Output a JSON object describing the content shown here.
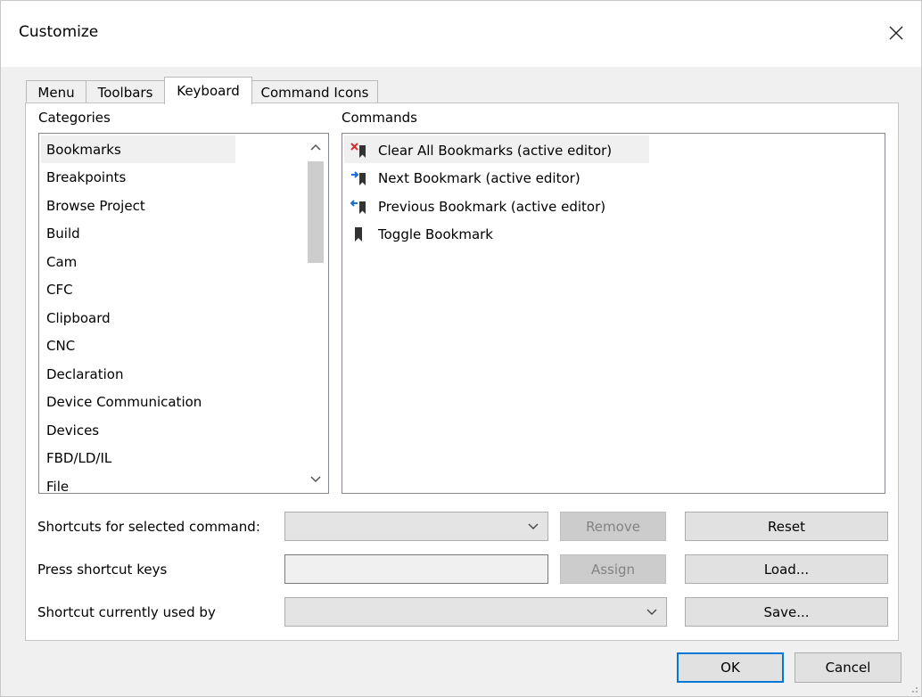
{
  "window": {
    "title": "Customize"
  },
  "tabs": [
    {
      "label": "Menu"
    },
    {
      "label": "Toolbars"
    },
    {
      "label": "Keyboard",
      "active": true
    },
    {
      "label": "Command Icons"
    }
  ],
  "categories": {
    "label": "Categories",
    "selected": "Bookmarks",
    "items": [
      "Bookmarks",
      "Breakpoints",
      "Browse Project",
      "Build",
      "Cam",
      "CFC",
      "Clipboard",
      "CNC",
      "Declaration",
      "Device Communication",
      "Devices",
      "FBD/LD/IL",
      "File"
    ]
  },
  "commands": {
    "label": "Commands",
    "selected": "Clear All Bookmarks (active editor)",
    "items": [
      {
        "label": "Clear All Bookmarks (active editor)",
        "icon": "clear-bookmarks-icon"
      },
      {
        "label": "Next Bookmark (active editor)",
        "icon": "next-bookmark-icon"
      },
      {
        "label": "Previous Bookmark (active editor)",
        "icon": "previous-bookmark-icon"
      },
      {
        "label": "Toggle Bookmark",
        "icon": "toggle-bookmark-icon"
      }
    ]
  },
  "shortcuts": {
    "selected_label": "Shortcuts for selected command:",
    "press_label": "Press shortcut keys",
    "used_by_label": "Shortcut currently used by",
    "selected_value": "",
    "press_value": "",
    "used_by_value": ""
  },
  "buttons": {
    "remove": "Remove",
    "assign": "Assign",
    "reset": "Reset",
    "load": "Load...",
    "save": "Save...",
    "ok": "OK",
    "cancel": "Cancel"
  },
  "colors": {
    "accent": "#0078d7",
    "selection_bg": "#f0f0f0",
    "disabled_bg": "#cccccc"
  }
}
